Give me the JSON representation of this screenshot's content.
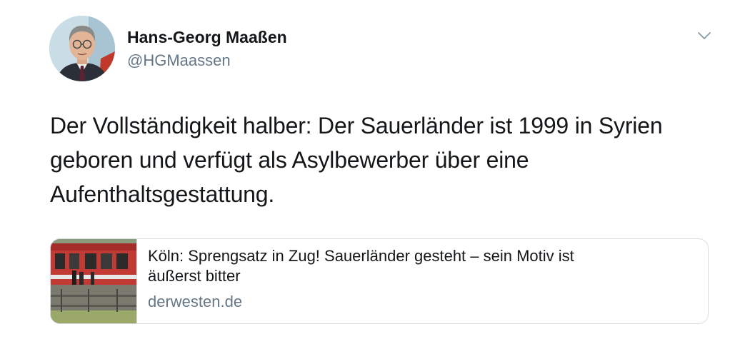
{
  "author": {
    "display_name": "Hans-Georg Maaßen",
    "handle": "@HGMaassen"
  },
  "tweet": {
    "lines": [
      "Der Vollständigkeit halber: Der Sauerländer ist 1999 in Syrien",
      "geboren und verfügt als Asylbewerber über eine",
      "Aufenthaltsgestattung."
    ]
  },
  "link_card": {
    "title_lines": [
      "Köln: Sprengsatz in Zug! Sauerländer gesteht – sein Motiv ist",
      "äußerst bitter"
    ],
    "domain": "derwesten.de"
  },
  "icons": {
    "menu": "chevron-down-icon"
  },
  "colors": {
    "text_primary": "#14171a",
    "text_secondary": "#657786",
    "card_border": "#d6dde3"
  }
}
